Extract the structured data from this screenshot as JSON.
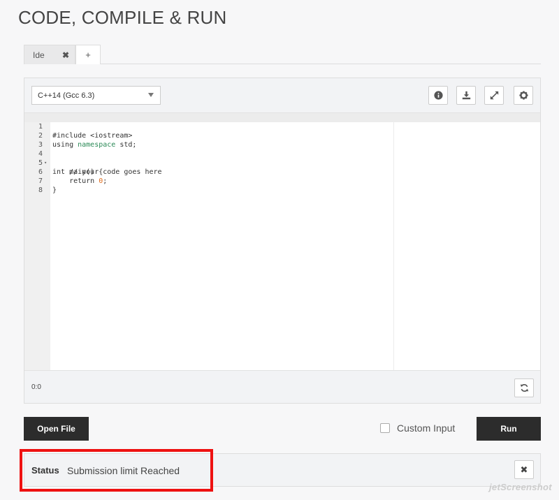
{
  "page": {
    "title": "CODE, COMPILE & RUN"
  },
  "tabs": [
    {
      "label": "Ide",
      "close_icon": "close-icon"
    },
    {
      "label": "+"
    }
  ],
  "editor": {
    "language": "C++14 (Gcc 6.3)",
    "toolbar_icons": [
      "info-icon",
      "download-icon",
      "expand-icon",
      "gear-icon"
    ],
    "cursor_position": "0:0",
    "lines": [
      {
        "num": "1",
        "code": "#include <iostream>"
      },
      {
        "num": "2",
        "code": "using namespace std;"
      },
      {
        "num": "3",
        "code": ""
      },
      {
        "num": "4",
        "code": "int main() {",
        "fold": "▾"
      },
      {
        "num": "5",
        "code": "    // your code goes here"
      },
      {
        "num": "6",
        "code": "    return 0;"
      },
      {
        "num": "7",
        "code": "}"
      },
      {
        "num": "8",
        "code": ""
      }
    ]
  },
  "actions": {
    "open_file_label": "Open File",
    "custom_input_label": "Custom Input",
    "custom_input_checked": false,
    "run_label": "Run"
  },
  "status": {
    "label": "Status",
    "message": "Submission limit Reached",
    "highlight_color": "#ee1111"
  },
  "watermark": "jetScreenshot",
  "colors": {
    "dark_button": "#2c2c2c",
    "background": "#f7f7f8"
  }
}
